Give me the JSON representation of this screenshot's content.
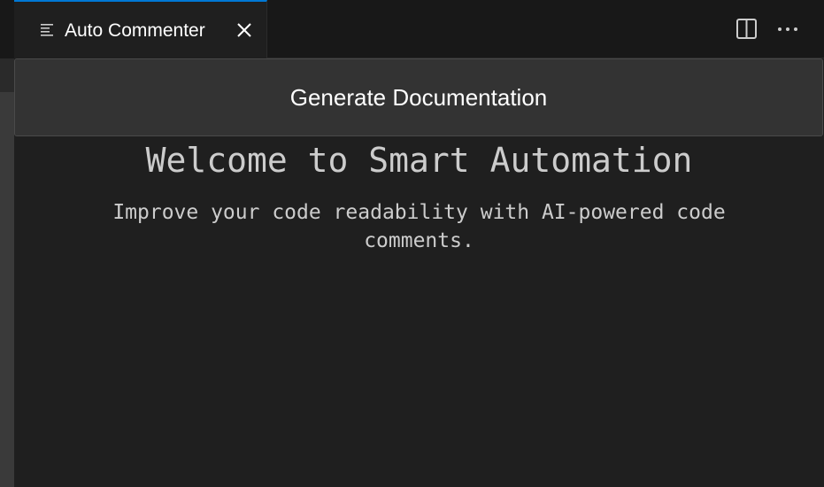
{
  "tab": {
    "label": "Auto Commenter",
    "icon": "preview-lines-icon",
    "close_icon": "close-icon",
    "accent_color": "#0078d4"
  },
  "toolbar": {
    "split_editor_icon": "split-editor-icon",
    "more_actions_icon": "more-actions-icon"
  },
  "main": {
    "generate_button_label": "Generate Documentation",
    "title": "Welcome to Smart Automation",
    "subtitle": "Improve your code readability with AI-powered code comments."
  }
}
